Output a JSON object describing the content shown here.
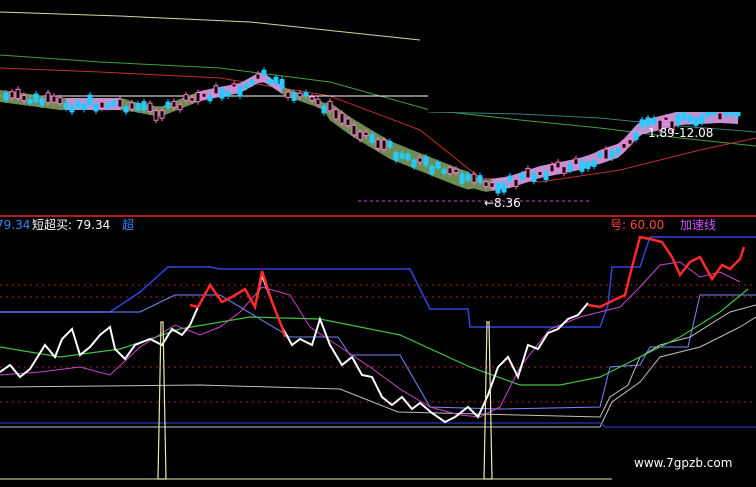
{
  "upper_panel": {
    "price_low_label": "←8.36",
    "price_range_label": "1.89-12.08",
    "colors": {
      "up_candle": "#ff77cc",
      "down_candle": "#22ccff",
      "ribbon_down": "#7a9a5a",
      "ribbon_up": "#d8a0e8",
      "ma_long": "#d8d8a0",
      "ma_mid": "#40a040",
      "ma_red": "#c03030",
      "hline": "#ffffff",
      "low_line": "#cc44cc"
    }
  },
  "lower_panel": {
    "legend": [
      {
        "text": "79.34",
        "color": "#3388ff"
      },
      {
        "text": "短超买: 79.34",
        "color": "#ffffff"
      },
      {
        "text": "超",
        "color": "#3388ff"
      }
    ],
    "legend_right": [
      {
        "text": "号: 60.00",
        "color": "#ff4444"
      },
      {
        "text": "加速线",
        "color": "#cc55ff"
      }
    ],
    "colors": {
      "main_line": "#ffffff",
      "main_hot": "#ff2a2a",
      "purple": "#cc44cc",
      "green": "#40c040",
      "blue": "#3344dd",
      "lightblue": "#7788ff",
      "spike": "#e8e8b0",
      "gray": "#c0c0c0"
    }
  },
  "watermark": "www.7gpzb.com"
}
